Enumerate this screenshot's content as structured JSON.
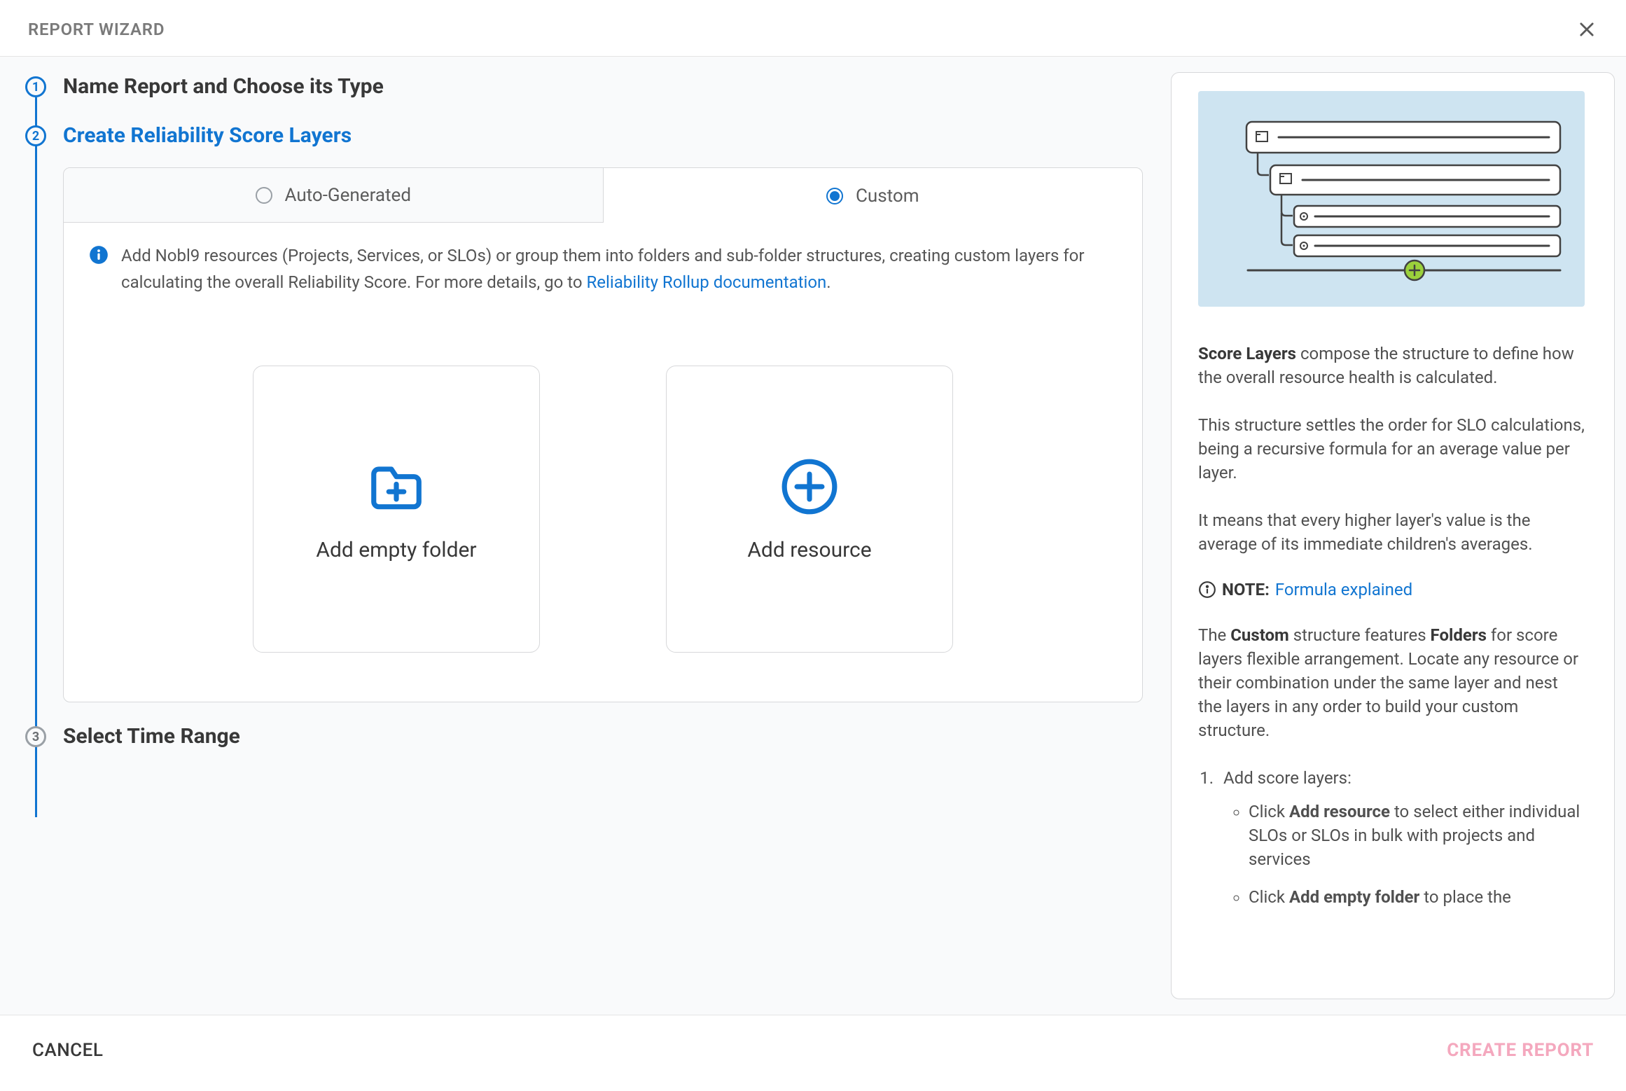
{
  "header": {
    "title": "REPORT WIZARD"
  },
  "steps": {
    "s1": {
      "num": "1",
      "title": "Name Report and Choose its Type"
    },
    "s2": {
      "num": "2",
      "title": "Create Reliability Score Layers"
    },
    "s3": {
      "num": "3",
      "title": "Select Time Range"
    }
  },
  "tabs": {
    "auto": "Auto-Generated",
    "custom": "Custom"
  },
  "info": {
    "text_a": "Add Nobl9 resources (Projects, Services, or SLOs) or group them into folders and sub-folder structures, creating custom layers for calculating the overall Reliability Score. For more details, go to ",
    "link": "Reliability Rollup documentation",
    "period": "."
  },
  "cards": {
    "folder": "Add empty folder",
    "resource": "Add resource"
  },
  "sidebar": {
    "p1_strong": "Score Layers",
    "p1_rest": " compose the structure to define how the overall resource health is calculated.",
    "p2": "This structure settles the order for SLO calculations, being a recursive formula for an average value per layer.",
    "p3": "It means that every higher layer's value is the average of its immediate children's averages.",
    "note_label": "NOTE:",
    "note_link": "Formula explained",
    "p4_a": "The ",
    "p4_b": "Custom",
    "p4_c": " structure features ",
    "p4_d": "Folders",
    "p4_e": " for score layers flexible arrangement. Locate any resource or their combination under the same layer and nest the layers in any order to build your custom structure.",
    "li1": "Add score layers:",
    "li1a_a": "Click ",
    "li1a_b": "Add resource",
    "li1a_c": " to select either individual SLOs or SLOs in bulk with projects and services",
    "li1b_a": "Click ",
    "li1b_b": "Add empty folder",
    "li1b_c": " to place the"
  },
  "footer": {
    "cancel": "CANCEL",
    "create": "CREATE REPORT"
  }
}
